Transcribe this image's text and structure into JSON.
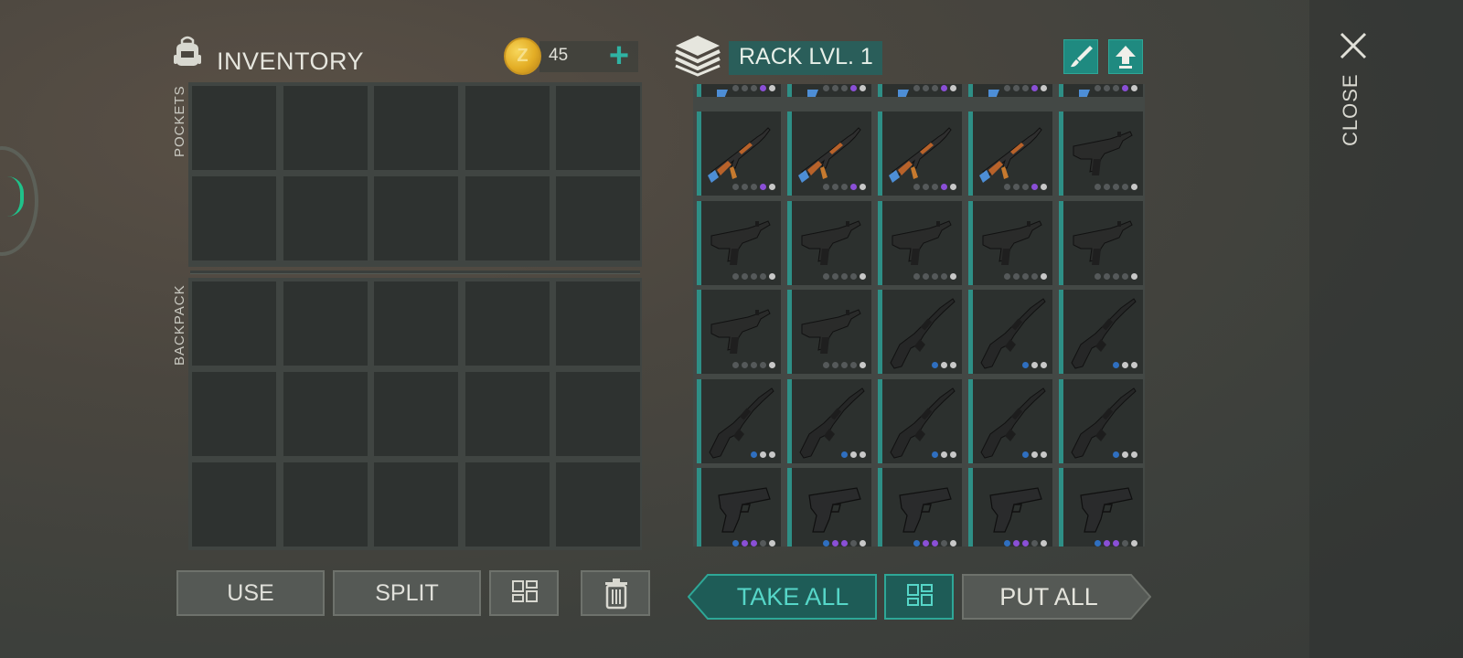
{
  "inventory": {
    "title": "INVENTORY",
    "currency": {
      "amount": "45",
      "coin_letter": "Z",
      "add_icon": "plus-icon"
    },
    "sections": {
      "pockets": "POCKETS",
      "backpack": "BACKPACK"
    },
    "buttons": {
      "use": "USE",
      "split": "SPLIT",
      "sort_icon": "grid-sort-icon",
      "delete_icon": "trash-icon"
    }
  },
  "rack": {
    "title": "RACK LVL. 1",
    "buttons": {
      "customize_icon": "brush-icon",
      "upgrade_icon": "upgrade-arrow-icon",
      "take_all": "TAKE ALL",
      "sort_icon": "grid-sort-icon",
      "put_all": "PUT ALL"
    },
    "rows": [
      [
        "partial",
        "partial",
        "partial",
        "partial",
        "partial"
      ],
      [
        "ak",
        "ak",
        "ak",
        "ak",
        "uzi"
      ],
      [
        "uzi",
        "uzi",
        "uzi",
        "uzi",
        "uzi"
      ],
      [
        "uzi",
        "uzi",
        "m16",
        "m16",
        "m16"
      ],
      [
        "m16",
        "m16",
        "m16",
        "m16",
        "m16"
      ],
      [
        "pistol",
        "pistol",
        "pistol",
        "pistol",
        "pistol"
      ]
    ],
    "dot_colors": {
      "partial": [
        "#55595a",
        "#55595a",
        "#55595a",
        "#8a4fd6",
        "#c8c8c8"
      ],
      "ak": [
        "#55595a",
        "#55595a",
        "#55595a",
        "#8a4fd6",
        "#c8c8c8"
      ],
      "uzi": [
        "#55595a",
        "#55595a",
        "#55595a",
        "#55595a",
        "#c8c8c8"
      ],
      "m16": [
        "#2f6fc0",
        "#c8c8c8",
        "#c8c8c8"
      ],
      "pistol": [
        "#2f6fc0",
        "#8a4fd6",
        "#8a4fd6",
        "#55595a",
        "#c8c8c8"
      ]
    }
  },
  "close": {
    "label": "CLOSE",
    "icon": "close-icon"
  },
  "colors": {
    "accent": "#2fb3a3",
    "teal_dark": "#1e5c57",
    "slot": "#2e3230"
  }
}
